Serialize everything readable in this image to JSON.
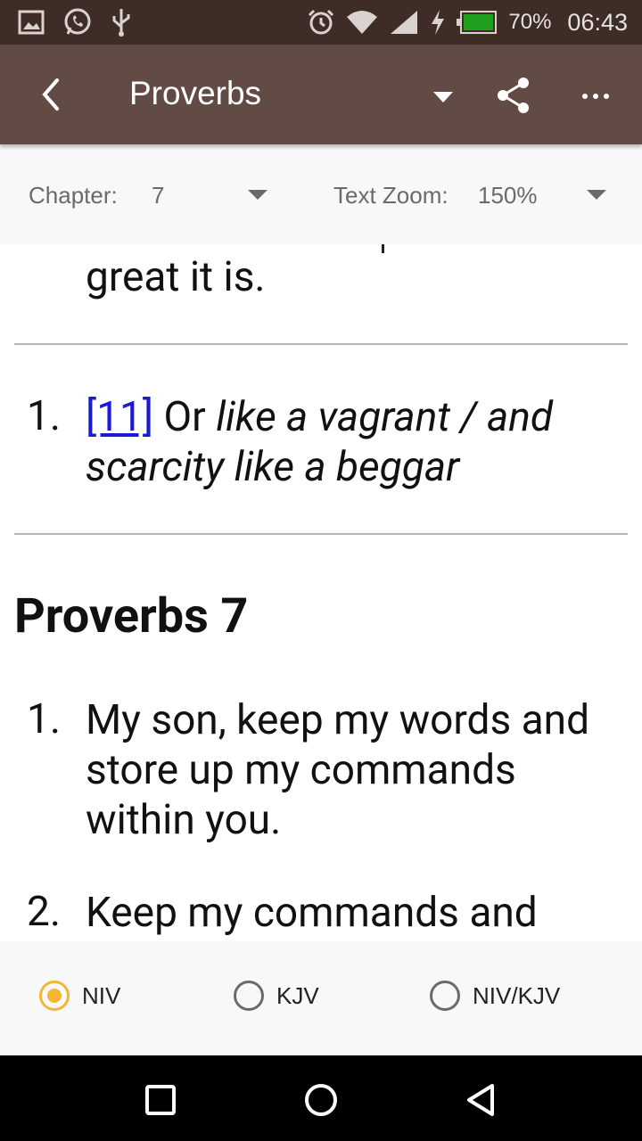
{
  "status_bar": {
    "icons_left": [
      "image-icon",
      "whatsapp-icon",
      "usb-icon"
    ],
    "icons_right": [
      "alarm-icon",
      "wifi-icon",
      "signal-icon",
      "charging-icon",
      "battery-icon"
    ],
    "battery_percent": "70%",
    "time": "06:43",
    "battery_color": "#1fa11f"
  },
  "app_bar": {
    "title": "Proverbs",
    "color": "#624b44"
  },
  "toolbar": {
    "chapter_label": "Chapter:",
    "chapter_value": "7",
    "zoom_label": "Text Zoom:",
    "zoom_value": "150%"
  },
  "content": {
    "prev_tail": "great it is.",
    "footnote": {
      "number": "1.",
      "ref": "[11]",
      "lead": "Or",
      "italic": "like a vagrant / and scarcity like a beggar"
    },
    "chapter_heading": "Proverbs 7",
    "verses": [
      {
        "number": "1.",
        "text": "My son, keep my words and store up my commands within you."
      },
      {
        "number": "2.",
        "text": "Keep my commands and"
      }
    ]
  },
  "versions": {
    "options": [
      "NIV",
      "KJV",
      "NIV/KJV"
    ],
    "selected": "NIV",
    "accent": "#f5b731"
  },
  "nav_bar": {
    "buttons": [
      "recents-square-icon",
      "home-circle-icon",
      "back-triangle-icon"
    ]
  }
}
